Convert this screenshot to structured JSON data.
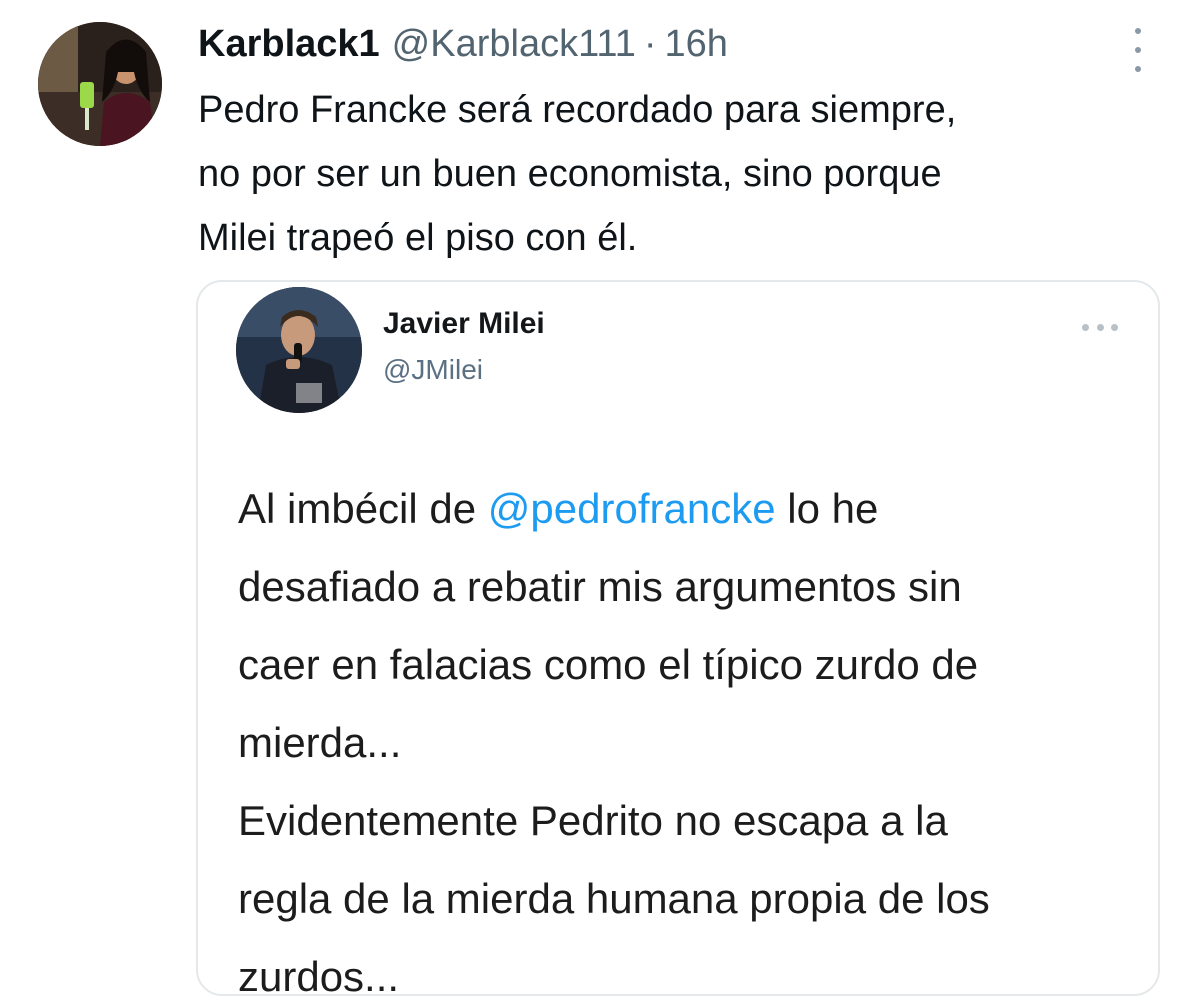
{
  "tweet": {
    "author": {
      "display_name": "Karblack1",
      "handle": "@Karblack111",
      "separator": "·",
      "time": "16h",
      "avatar_icon": "profile-photo-woman-with-drink"
    },
    "text_lines": [
      "Pedro Francke será recordado para siempre,",
      "no por ser un buen economista, sino porque",
      "Milei trapeó el piso con él."
    ],
    "more_icon": "more-vertical-icon"
  },
  "quoted_tweet": {
    "author": {
      "display_name": "Javier Milei",
      "handle": "@JMilei",
      "avatar_icon": "profile-photo-man-at-microphone"
    },
    "more_icon": "more-horizontal-icon",
    "body": {
      "line1_before": "Al imbécil de ",
      "mention": "@pedrofrancke",
      "line1_after": " lo he",
      "lines": [
        "desafiado a rebatir mis argumentos sin",
        "caer en falacias como el típico zurdo de",
        "mierda...",
        "Evidentemente Pedrito no escapa a la",
        "regla de la mierda humana propia de los",
        "zurdos..."
      ]
    }
  },
  "colors": {
    "text_primary": "#0f1419",
    "text_secondary": "#536471",
    "mention": "#1d9bf0",
    "card_border": "#e4e8eb"
  }
}
